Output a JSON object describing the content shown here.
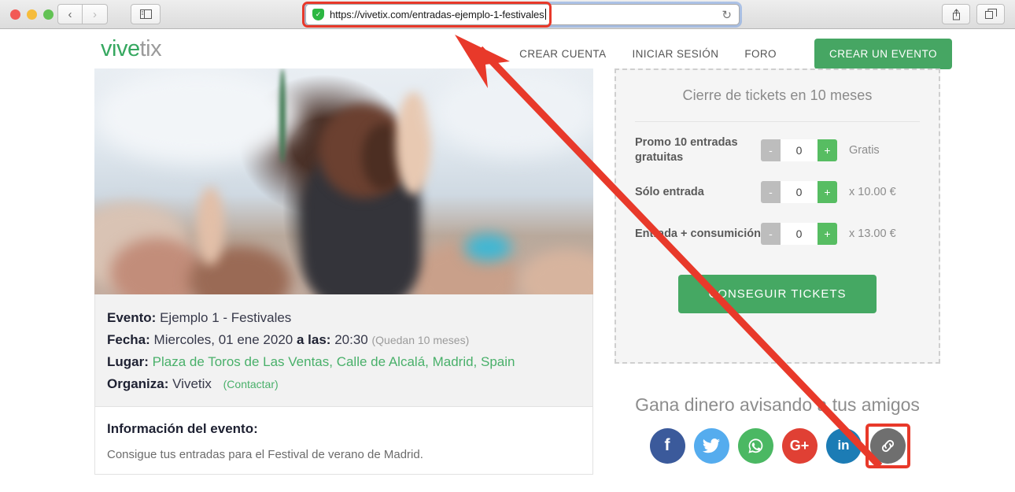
{
  "browser": {
    "url": "https://vivetix.com/entradas-ejemplo-1-festivales",
    "back_icon": "‹",
    "forward_icon": "›",
    "sidebar_icon": "sidebar",
    "shield_icon": "✓",
    "reload_icon": "↻",
    "share_icon": "⇧",
    "tabs_icon": "⧉"
  },
  "header": {
    "logo_part1": "vive",
    "logo_part2": "tix",
    "nav": [
      {
        "label": "CREAR CUENTA"
      },
      {
        "label": "INICIAR SESIÓN"
      },
      {
        "label": "FORO"
      }
    ],
    "cta_label": "CREAR UN EVENTO"
  },
  "event": {
    "label_evento": "Evento:",
    "name": "Ejemplo 1 - Festivales",
    "label_fecha": "Fecha:",
    "date": "Miercoles, 01 ene 2020",
    "label_alas": "a las:",
    "time": "20:30",
    "remaining": "(Quedan 10 meses)",
    "label_lugar": "Lugar:",
    "venue": "Plaza de Toros de Las Ventas, Calle de Alcalá, Madrid, Spain",
    "label_organiza": "Organiza:",
    "organizer": "Vivetix",
    "contact_link": "(Contactar)"
  },
  "info": {
    "title": "Información del evento:",
    "text": "Consigue tus entradas para el Festival de verano de Madrid."
  },
  "tickets": {
    "panel_title": "Cierre de tickets en 10 meses",
    "minus_label": "-",
    "plus_label": "+",
    "rows": [
      {
        "name": "Promo 10 entradas gratuitas",
        "value": "0",
        "price": "Gratis"
      },
      {
        "name": "Sólo entrada",
        "value": "0",
        "price": "x 10.00 €"
      },
      {
        "name": "Entrada + consumición",
        "value": "0",
        "price": "x 13.00 €"
      }
    ],
    "cta_label": "CONSEGUIR TICKETS"
  },
  "share": {
    "title": "Gana dinero avisando a tus amigos",
    "icons": [
      {
        "name": "facebook",
        "glyph": "f"
      },
      {
        "name": "twitter",
        "glyph": "🐦"
      },
      {
        "name": "whatsapp",
        "glyph": "✆"
      },
      {
        "name": "googleplus",
        "glyph": "G+"
      },
      {
        "name": "linkedin",
        "glyph": "in"
      },
      {
        "name": "link",
        "glyph": "🔗"
      }
    ]
  },
  "colors": {
    "brand_green": "#45a863",
    "annotation_red": "#e8392a",
    "link_green": "#49b06a"
  }
}
